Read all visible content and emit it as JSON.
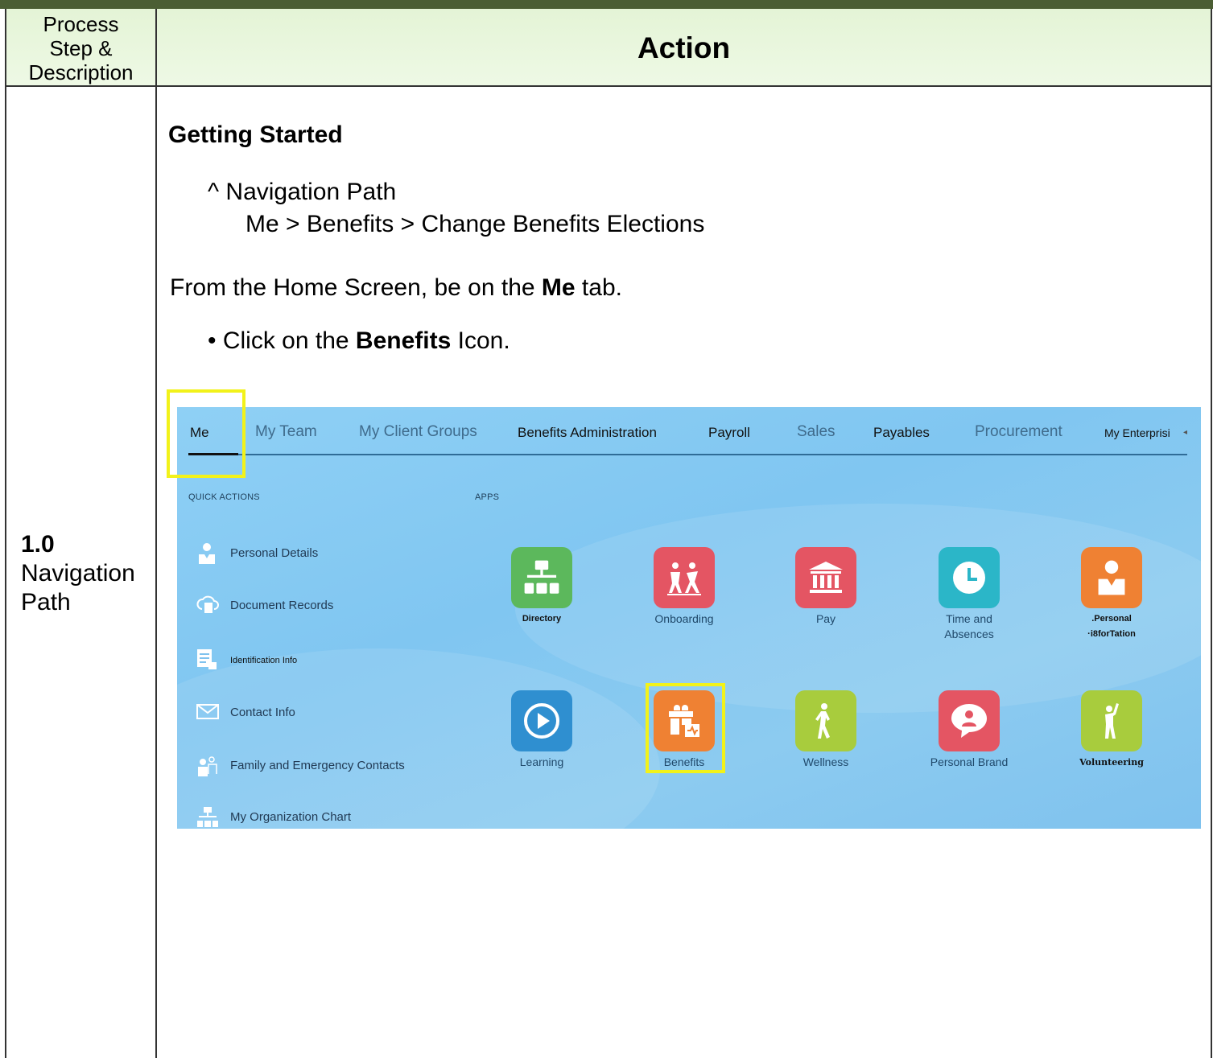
{
  "table": {
    "header_left": "Process\nStep &\nDescription",
    "header_right": "Action",
    "step_number": "1.0",
    "step_title": "Navigation Path"
  },
  "content": {
    "heading": "Getting Started",
    "nav_path_label": "^ Navigation Path",
    "nav_path": "Me > Benefits > Change Benefits Elections",
    "instruction_pre": "From the Home Screen, be on the ",
    "instruction_bold": "Me",
    "instruction_post": " tab.",
    "bullet_pre": "• Click on the ",
    "bullet_bold": "Benefits",
    "bullet_post": " Icon."
  },
  "screenshot": {
    "tabs": [
      {
        "label": "Me"
      },
      {
        "label": "My Team"
      },
      {
        "label": "My Client Groups"
      },
      {
        "label": "Benefits Administration"
      },
      {
        "label": "Payroll"
      },
      {
        "label": "Sales"
      },
      {
        "label": "Payables"
      },
      {
        "label": "Procurement"
      },
      {
        "label": "My Enterprisi"
      }
    ],
    "quick_actions_label": "QUICK ACTIONS",
    "apps_label": "APPS",
    "quick_actions": [
      {
        "label": "Personal Details",
        "icon": "person-icon"
      },
      {
        "label": "Document Records",
        "icon": "cloud-document-icon"
      },
      {
        "label": "Identification Info",
        "icon": "id-card-icon"
      },
      {
        "label": "Contact Info",
        "icon": "envelope-icon"
      },
      {
        "label": "Family and Emergency Contacts",
        "icon": "family-icon"
      },
      {
        "label": "My Organization Chart",
        "icon": "org-chart-icon"
      }
    ],
    "apps": [
      {
        "label": "Directory",
        "icon": "org-chart-icon",
        "color": "#5cb85c"
      },
      {
        "label": "Onboarding",
        "icon": "onboarding-icon",
        "color": "#e45563"
      },
      {
        "label": "Pay",
        "icon": "bank-icon",
        "color": "#e45563"
      },
      {
        "label": "Time and\nAbsences",
        "icon": "clock-icon",
        "color": "#2bb6c8"
      },
      {
        "label": ".Personal\n·i8forTation",
        "icon": "person-icon",
        "color": "#ef8133"
      },
      {
        "label": "Learning",
        "icon": "play-icon",
        "color": "#2f8fd0"
      },
      {
        "label": "Benefits",
        "icon": "gift-icon",
        "color": "#ef8133"
      },
      {
        "label": "Wellness",
        "icon": "wellness-icon",
        "color": "#a8cc3d"
      },
      {
        "label": "Personal Brand",
        "icon": "chat-person-icon",
        "color": "#e45563"
      },
      {
        "label": "Volunteering",
        "icon": "volunteer-icon",
        "color": "#a8cc3d"
      }
    ],
    "highlight_color": "#f2f21a"
  }
}
